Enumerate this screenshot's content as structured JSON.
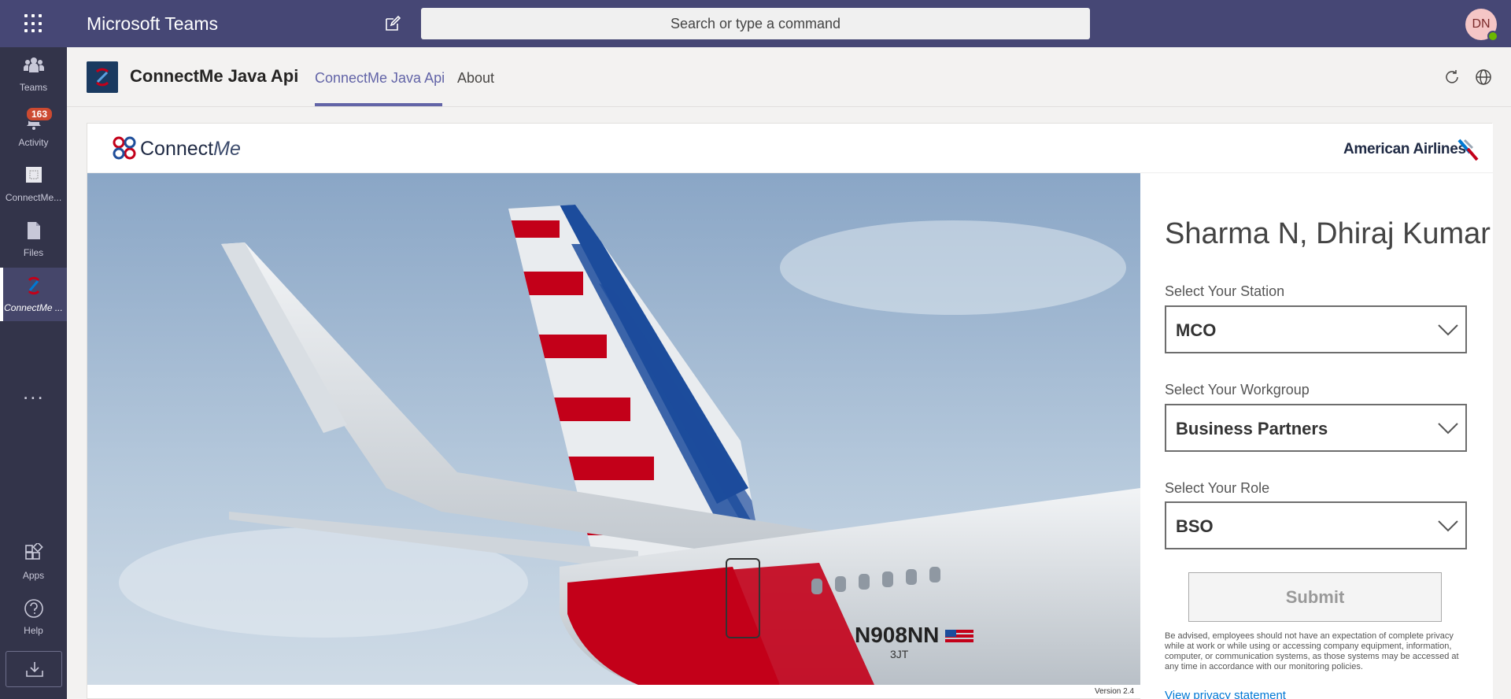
{
  "topbar": {
    "app_name": "Microsoft Teams",
    "search_placeholder": "Search or type a command",
    "avatar_initials": "DN"
  },
  "rail": {
    "items": [
      {
        "label": "Teams",
        "icon": "teams-icon"
      },
      {
        "label": "Activity",
        "icon": "bell-icon",
        "badge": "163"
      },
      {
        "label": "ConnectMe...",
        "icon": "app-icon"
      },
      {
        "label": "Files",
        "icon": "file-icon"
      },
      {
        "label": "ConnectMe ...",
        "icon": "connectme-icon",
        "active": true
      }
    ],
    "more_label": "...",
    "bottom": [
      {
        "label": "Apps",
        "icon": "apps-icon"
      },
      {
        "label": "Help",
        "icon": "help-icon"
      }
    ]
  },
  "app_header": {
    "title": "ConnectMe Java Api",
    "tabs": [
      {
        "label": "ConnectMe Java Api",
        "active": true
      },
      {
        "label": "About",
        "active": false
      }
    ]
  },
  "content": {
    "brand_name_main": "Connect",
    "brand_name_italic": "Me",
    "airline_name": "American Airlines",
    "version": "Version 2.4",
    "hero_registration": "N908NN",
    "hero_sub": "3JT",
    "form": {
      "user_name": "Sharma N, Dhiraj Kumar",
      "station_label": "Select Your Station",
      "station_value": "MCO",
      "workgroup_label": "Select Your Workgroup",
      "workgroup_value": "Business Partners",
      "role_label": "Select Your Role",
      "role_value": "BSO",
      "submit_label": "Submit",
      "disclaimer": "Be advised, employees should not have an expectation of complete privacy while at work or while using or accessing company equipment, information, computer, or communication systems, as those systems may be accessed at any time in accordance with our monitoring policies.",
      "privacy_link": "View privacy statement"
    }
  },
  "colors": {
    "topbar": "#464775",
    "rail": "#33344a",
    "accent": "#6264a7",
    "aa_red": "#c30019",
    "aa_blue": "#0078d2"
  }
}
